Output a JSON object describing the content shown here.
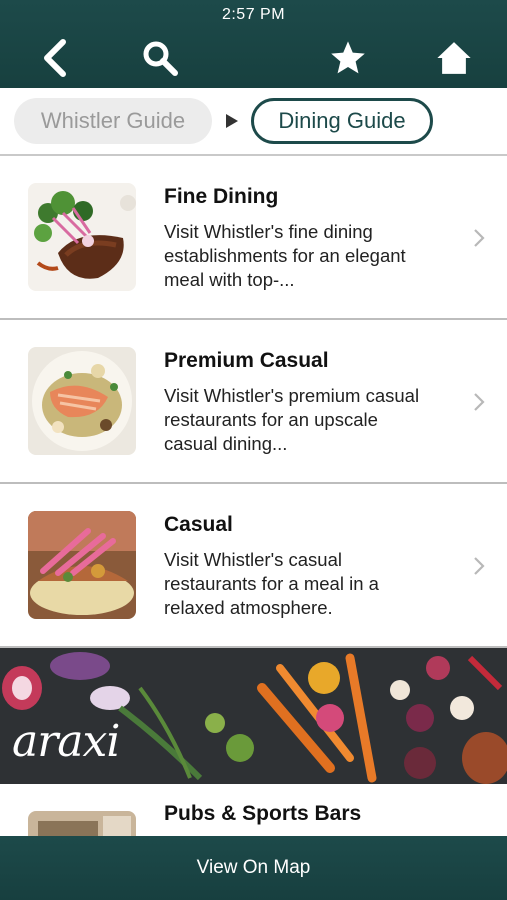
{
  "status": {
    "time": "2:57 PM"
  },
  "nav": {
    "back_icon": "back-chevron-icon",
    "search_icon": "search-icon",
    "favorite_icon": "star-icon",
    "home_icon": "home-icon",
    "bar_color": "#1d4a4a"
  },
  "breadcrumb": {
    "items": [
      {
        "label": "Whistler Guide"
      },
      {
        "label": "Dining Guide"
      }
    ]
  },
  "list": {
    "items": [
      {
        "title": "Fine Dining",
        "description": "Visit Whistler's fine dining establishments for an elegant meal with top-..."
      },
      {
        "title": "Premium Casual",
        "description": "Visit Whistler's premium casual restaurants for an upscale casual dining..."
      },
      {
        "title": "Casual",
        "description": "Visit Whistler's casual restaurants for a meal in a relaxed atmosphere."
      },
      {
        "title": "Pubs & Sports Bars",
        "description": ""
      }
    ]
  },
  "banner": {
    "logo_text": "araxi"
  },
  "footer": {
    "map_label": "View On Map"
  }
}
